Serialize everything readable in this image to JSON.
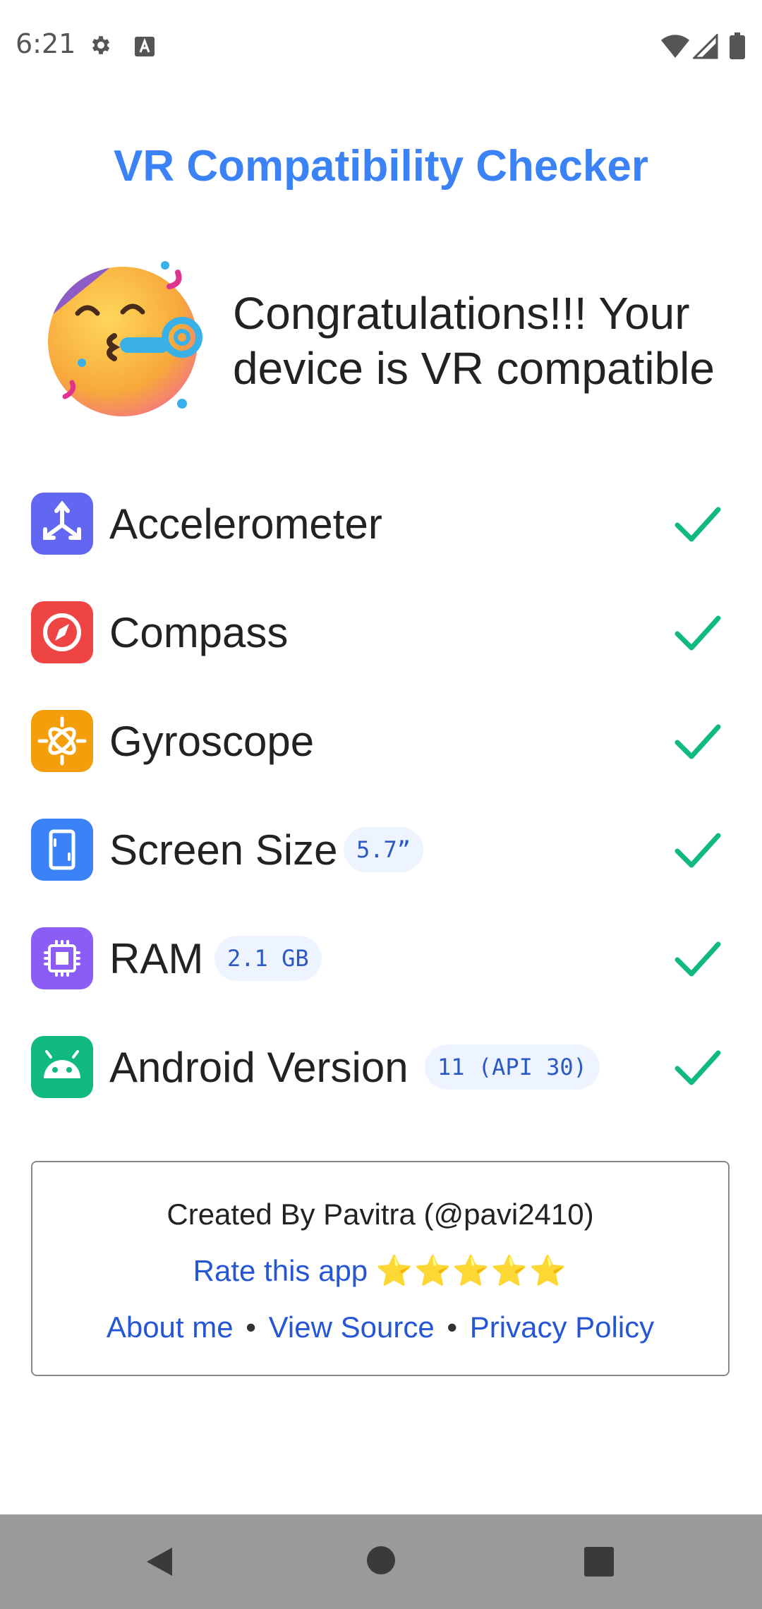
{
  "status_bar": {
    "time": "6:21",
    "icons": [
      "settings-gear-icon",
      "text-a-icon",
      "wifi-icon",
      "signal-icon",
      "battery-icon"
    ]
  },
  "app": {
    "title": "VR Compatibility Checker",
    "title_color": "#3b82f6"
  },
  "congrats": {
    "emoji_icon": "partying-face-icon",
    "message": "Congratulations!!! Your device is VR compatible"
  },
  "checks": [
    {
      "label": "Accelerometer",
      "icon": "accelerometer-axes-icon",
      "icon_color": "#6366f1",
      "badge": "",
      "status": "passed"
    },
    {
      "label": "Compass",
      "icon": "compass-icon",
      "icon_color": "#ef4444",
      "badge": "",
      "status": "passed"
    },
    {
      "label": "Gyroscope",
      "icon": "gyroscope-icon",
      "icon_color": "#f59e0b",
      "badge": "",
      "status": "passed"
    },
    {
      "label": "Screen Size",
      "icon": "phone-screen-icon",
      "icon_color": "#3b82f6",
      "badge": "5.7”",
      "status": "passed"
    },
    {
      "label": "RAM",
      "icon": "chip-icon",
      "icon_color": "#8b5cf6",
      "badge": "2.1 GB",
      "status": "passed"
    },
    {
      "label": "Android Version",
      "icon": "android-icon",
      "icon_color": "#10b981",
      "badge": "11 (API 30)",
      "status": "passed"
    }
  ],
  "check_color": "#10b981",
  "footer": {
    "created_by": "Created By Pavitra (@pavi2410)",
    "rate_label": "Rate this app",
    "rate_stars": "⭐⭐⭐⭐⭐",
    "links": {
      "about": "About me",
      "source": "View Source",
      "privacy": "Privacy Policy",
      "separator": "•"
    }
  },
  "nav_bar": {
    "buttons": [
      "back-icon",
      "home-icon",
      "recents-icon"
    ]
  }
}
